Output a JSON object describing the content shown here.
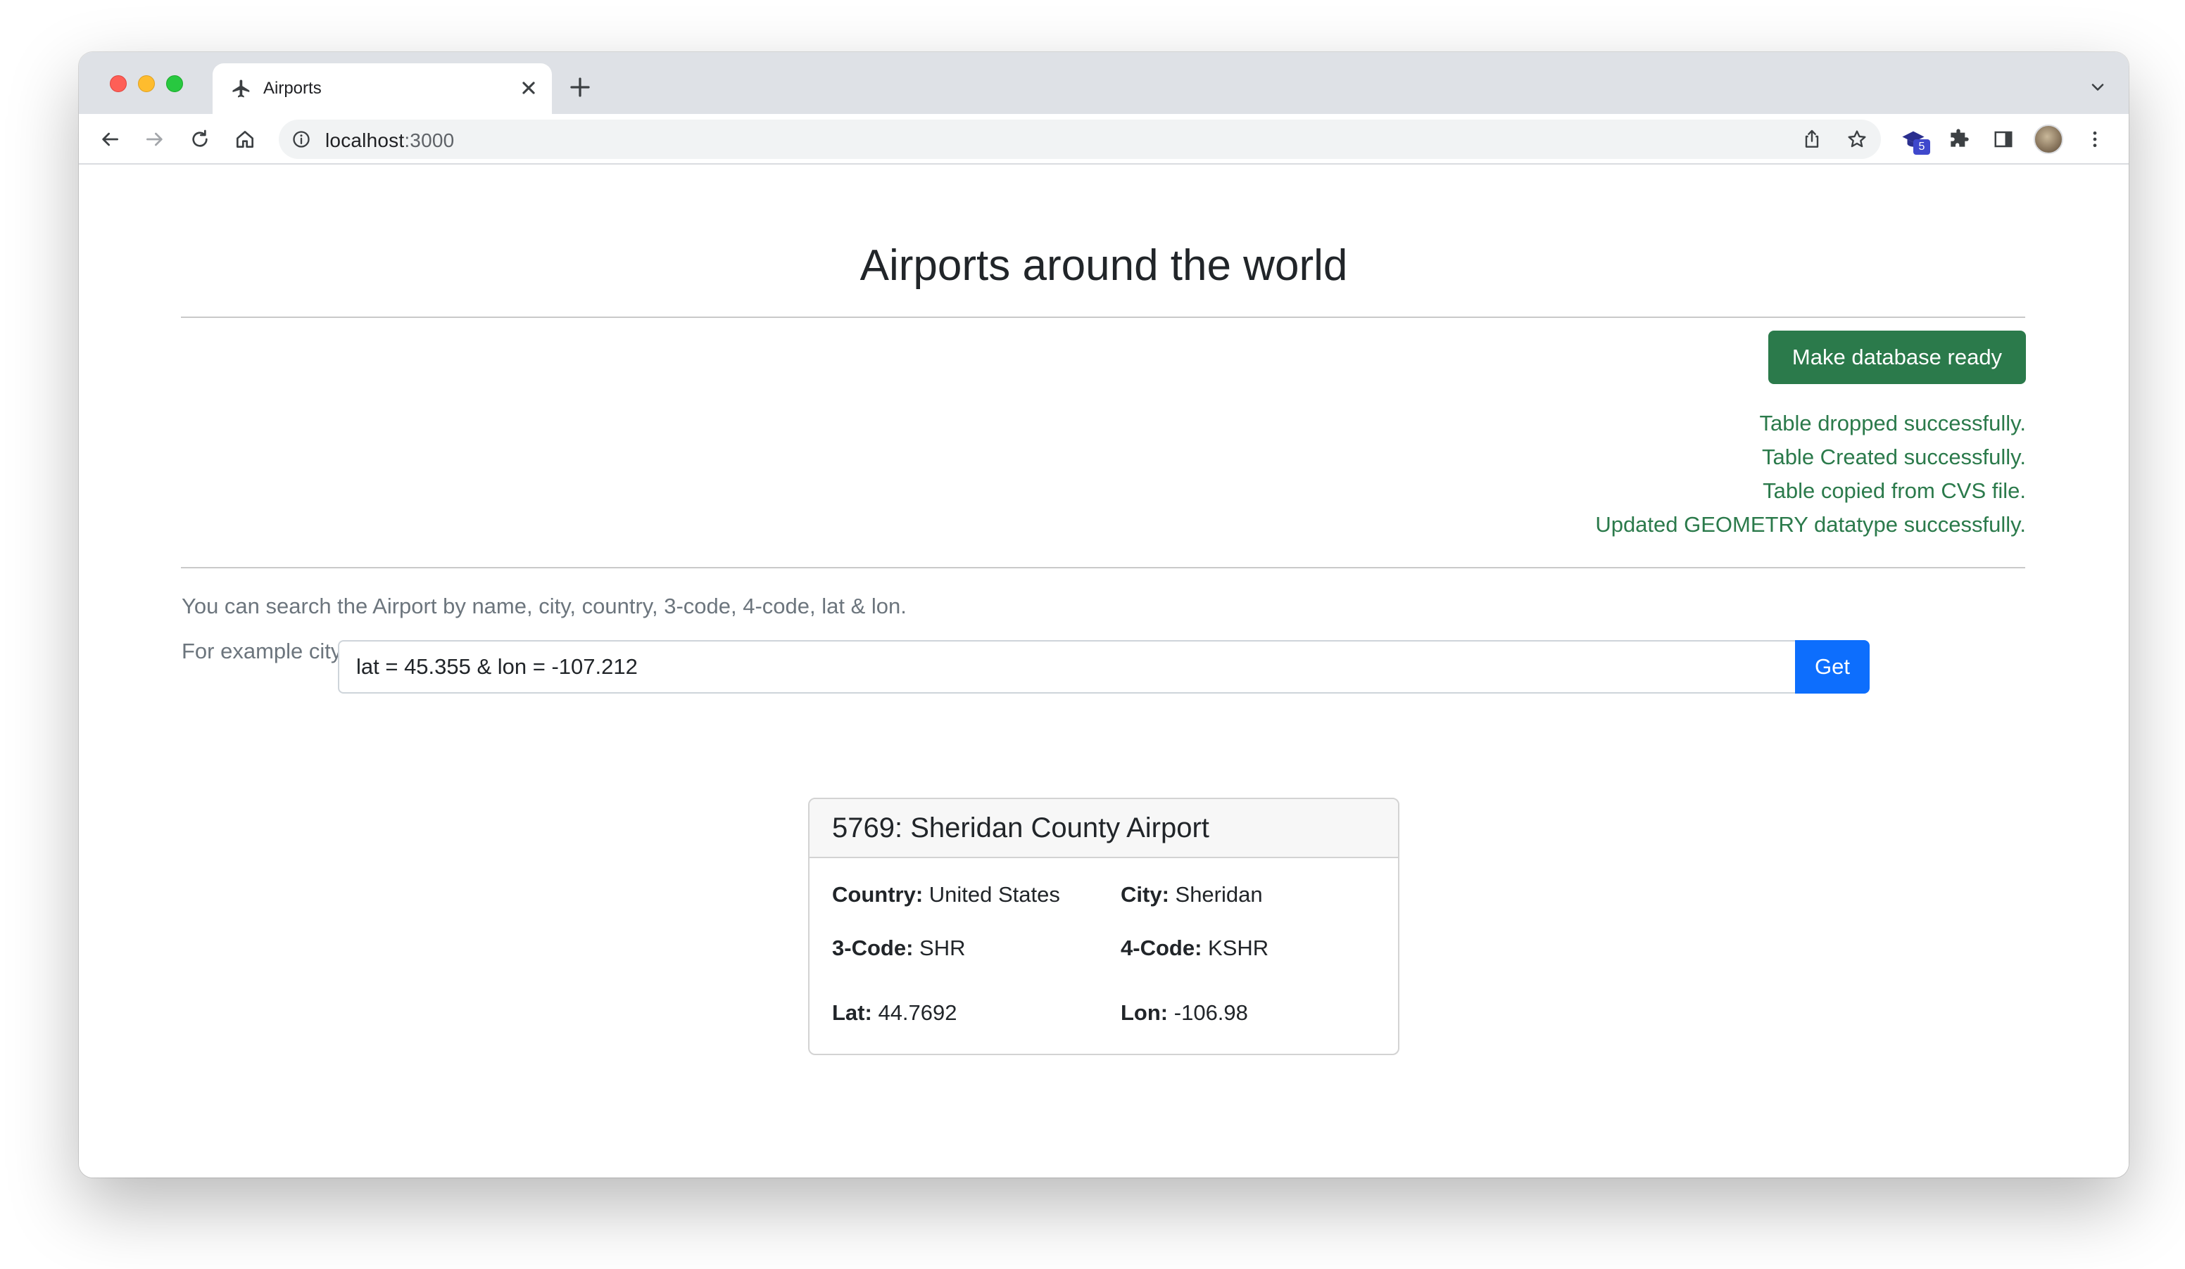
{
  "browser": {
    "tab_title": "Airports",
    "url_host": "localhost",
    "url_port": ":3000",
    "extension_badge": "5"
  },
  "page": {
    "title": "Airports around the world",
    "db_button_label": "Make database ready",
    "status_messages": [
      "Table dropped successfully.",
      "Table Created successfully.",
      "Table copied from CVS file.",
      "Updated GEOMETRY datatype successfully."
    ],
    "help_text": "You can search the Airport by name, city, country, 3-code, 4-code, lat & lon.",
    "example_text": "For example city = Calgary",
    "search_value": "lat = 45.355 & lon = -107.212",
    "get_button_label": "Get"
  },
  "result": {
    "header": "5769: Sheridan County Airport",
    "country_label": "Country:",
    "country": "United States",
    "city_label": "City:",
    "city": "Sheridan",
    "code3_label": "3-Code:",
    "code3": "SHR",
    "code4_label": "4-Code:",
    "code4": "KSHR",
    "lat_label": "Lat:",
    "lat": "44.7692",
    "lon_label": "Lon:",
    "lon": "-106.98"
  },
  "colors": {
    "success_green": "#2b7a4b",
    "primary_blue": "#0d6efd"
  }
}
